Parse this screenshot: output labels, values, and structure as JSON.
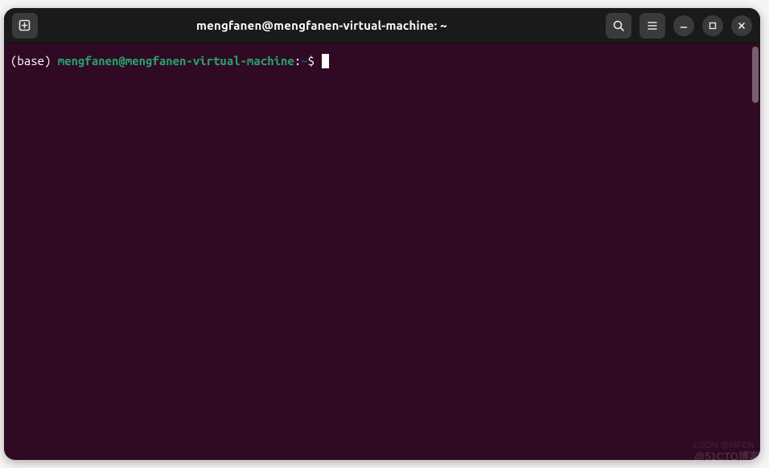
{
  "titlebar": {
    "title": "mengfanen@mengfanen-virtual-machine: ~"
  },
  "prompt": {
    "env": "(base) ",
    "userhost": "mengfanen@mengfanen-virtual-machine",
    "colon": ":",
    "path": "~",
    "dollar": "$ "
  },
  "watermarks": {
    "primary": "@51CTO博客",
    "secondary": "CSDN @MFEN"
  }
}
